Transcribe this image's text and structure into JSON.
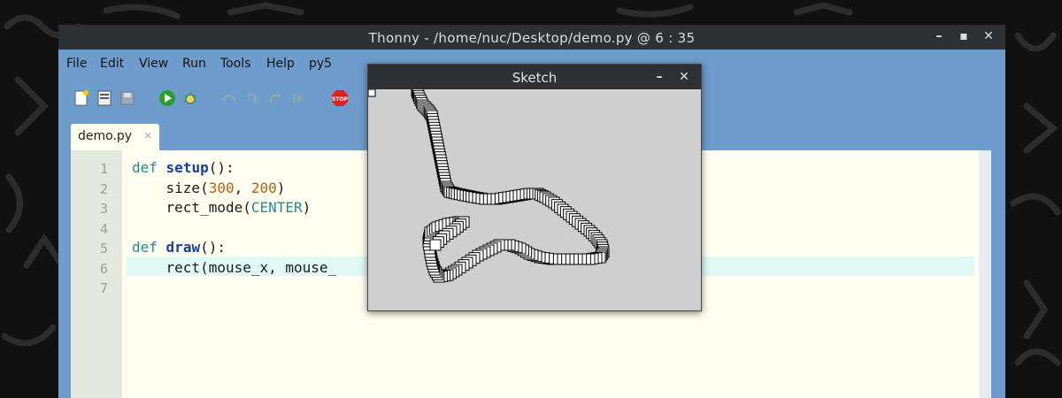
{
  "thonny": {
    "title": "Thonny - /home/nuc/Desktop/demo.py @ 6 : 35",
    "menu": [
      "File",
      "Edit",
      "View",
      "Run",
      "Tools",
      "Help",
      "py5"
    ],
    "toolbar_icons": [
      "new-file-icon",
      "open-file-icon",
      "save-icon",
      "run-icon",
      "debug-icon",
      "step-over-icon",
      "step-into-icon",
      "step-out-icon",
      "resume-icon",
      "stop-icon"
    ],
    "tab": {
      "label": "demo.py",
      "close": "×"
    },
    "line_numbers": [
      "1",
      "2",
      "3",
      "4",
      "5",
      "6",
      "7"
    ],
    "code": {
      "l1_kw": "def",
      "l1_fn": "setup",
      "l1_rest": "():",
      "l2_a": "    size(",
      "l2_n1": "300",
      "l2_b": ", ",
      "l2_n2": "200",
      "l2_c": ")",
      "l3_a": "    rect_mode(",
      "l3_kw": "CENTER",
      "l3_c": ")",
      "l5_kw": "def",
      "l5_fn": "draw",
      "l5_rest": "():",
      "l6": "    rect(mouse_x, mouse_"
    },
    "highlighted_line": 6
  },
  "sketch": {
    "title": "Sketch",
    "minimize": "–",
    "close": "✕",
    "canvas_background": "#cfcfcf"
  },
  "colors": {
    "editor_bg": "#fffff1",
    "window_frame": "#6e9ccc",
    "titlebar": "#2e3133"
  }
}
